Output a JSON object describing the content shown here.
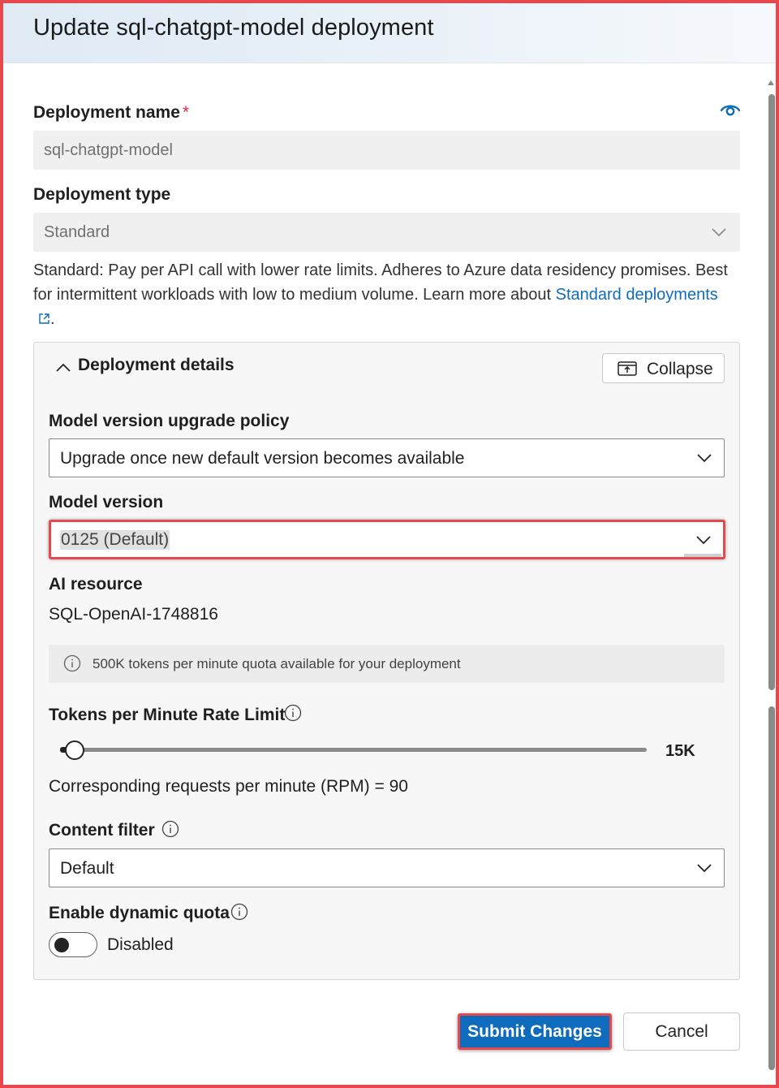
{
  "dialog": {
    "title": "Update sql-chatgpt-model deployment"
  },
  "deployment_name": {
    "label": "Deployment name",
    "required_marker": "*",
    "value": "sql-chatgpt-model",
    "icon": "eye-icon"
  },
  "deployment_type": {
    "label": "Deployment type",
    "value": "Standard",
    "description_text": "Standard: Pay per API call with lower rate limits. Adheres to Azure data residency promises. Best for intermittent workloads with low to medium volume. Learn more about ",
    "link_text": "Standard deployments",
    "description_end": "."
  },
  "details_panel": {
    "title": "Deployment details",
    "collapse_label": "Collapse",
    "upgrade_policy": {
      "label": "Model version upgrade policy",
      "value": "Upgrade once new default version becomes available"
    },
    "model_version": {
      "label": "Model version",
      "value": "0125 (Default)"
    },
    "ai_resource": {
      "label": "AI resource",
      "value": "SQL-OpenAI-1748816"
    },
    "quota_info": "500K tokens per minute quota available for your deployment",
    "rate_limit": {
      "label": "Tokens per Minute Rate Limit",
      "value_text": "15K",
      "level": 0.03,
      "rpm_text": "Corresponding requests per minute (RPM) = 90"
    },
    "content_filter": {
      "label": "Content filter",
      "value": "Default"
    },
    "dynamic_quota": {
      "label": "Enable dynamic quota",
      "state_text": "Disabled",
      "enabled": false
    }
  },
  "actions": {
    "submit_label": "Submit Changes",
    "cancel_label": "Cancel"
  },
  "colors": {
    "accent": "#0f6cbd",
    "highlight_border": "#e5484d",
    "required": "#c4314b"
  }
}
